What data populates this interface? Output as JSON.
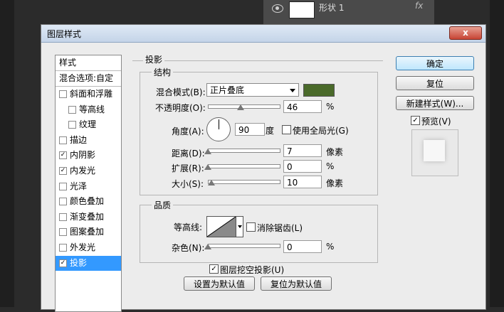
{
  "layers_panel": {
    "layer_name": "形状 1",
    "fx_label": "fx"
  },
  "dialog": {
    "title": "图层样式",
    "close_glyph": "x"
  },
  "style_list": {
    "header": "样式",
    "blend_options": "混合选项:自定",
    "items": [
      {
        "label": "斜面和浮雕",
        "checked": false
      },
      {
        "label": "等高线",
        "checked": false
      },
      {
        "label": "纹理",
        "checked": false
      },
      {
        "label": "描边",
        "checked": false
      },
      {
        "label": "内阴影",
        "checked": true
      },
      {
        "label": "内发光",
        "checked": true
      },
      {
        "label": "光泽",
        "checked": false
      },
      {
        "label": "颜色叠加",
        "checked": false
      },
      {
        "label": "渐变叠加",
        "checked": false
      },
      {
        "label": "图案叠加",
        "checked": false
      },
      {
        "label": "外发光",
        "checked": false
      },
      {
        "label": "投影",
        "checked": true
      }
    ],
    "check_glyph": "✓"
  },
  "drop_shadow": {
    "section_title": "投影",
    "structure": {
      "title": "结构",
      "blend_mode_label": "混合模式(B):",
      "blend_mode_value": "正片叠底",
      "shadow_color": "#4a6a2a",
      "opacity_label": "不透明度(O):",
      "opacity_value": "46",
      "opacity_unit": "%",
      "angle_label": "角度(A):",
      "angle_value": "90",
      "angle_unit": "度",
      "global_light_label": "使用全局光(G)",
      "global_light_checked": false,
      "distance_label": "距离(D):",
      "distance_value": "7",
      "distance_unit": "像素",
      "spread_label": "扩展(R):",
      "spread_value": "0",
      "spread_unit": "%",
      "size_label": "大小(S):",
      "size_value": "10",
      "size_unit": "像素"
    },
    "quality": {
      "title": "品质",
      "contour_label": "等高线:",
      "anti_alias_label": "消除锯齿(L)",
      "anti_alias_checked": false,
      "noise_label": "杂色(N):",
      "noise_value": "0",
      "noise_unit": "%"
    },
    "knockout_label": "图层挖空投影(U)",
    "knockout_checked": true,
    "make_default_label": "设置为默认值",
    "reset_default_label": "复位为默认值"
  },
  "buttons": {
    "ok": "确定",
    "reset": "复位",
    "new_style": "新建样式(W)...",
    "preview_label": "预览(V)",
    "preview_checked": true
  },
  "slider_levels": {
    "opacity": 0.46,
    "distance": 0.0,
    "spread": 0.0,
    "size": 0.05,
    "noise": 0.0
  }
}
